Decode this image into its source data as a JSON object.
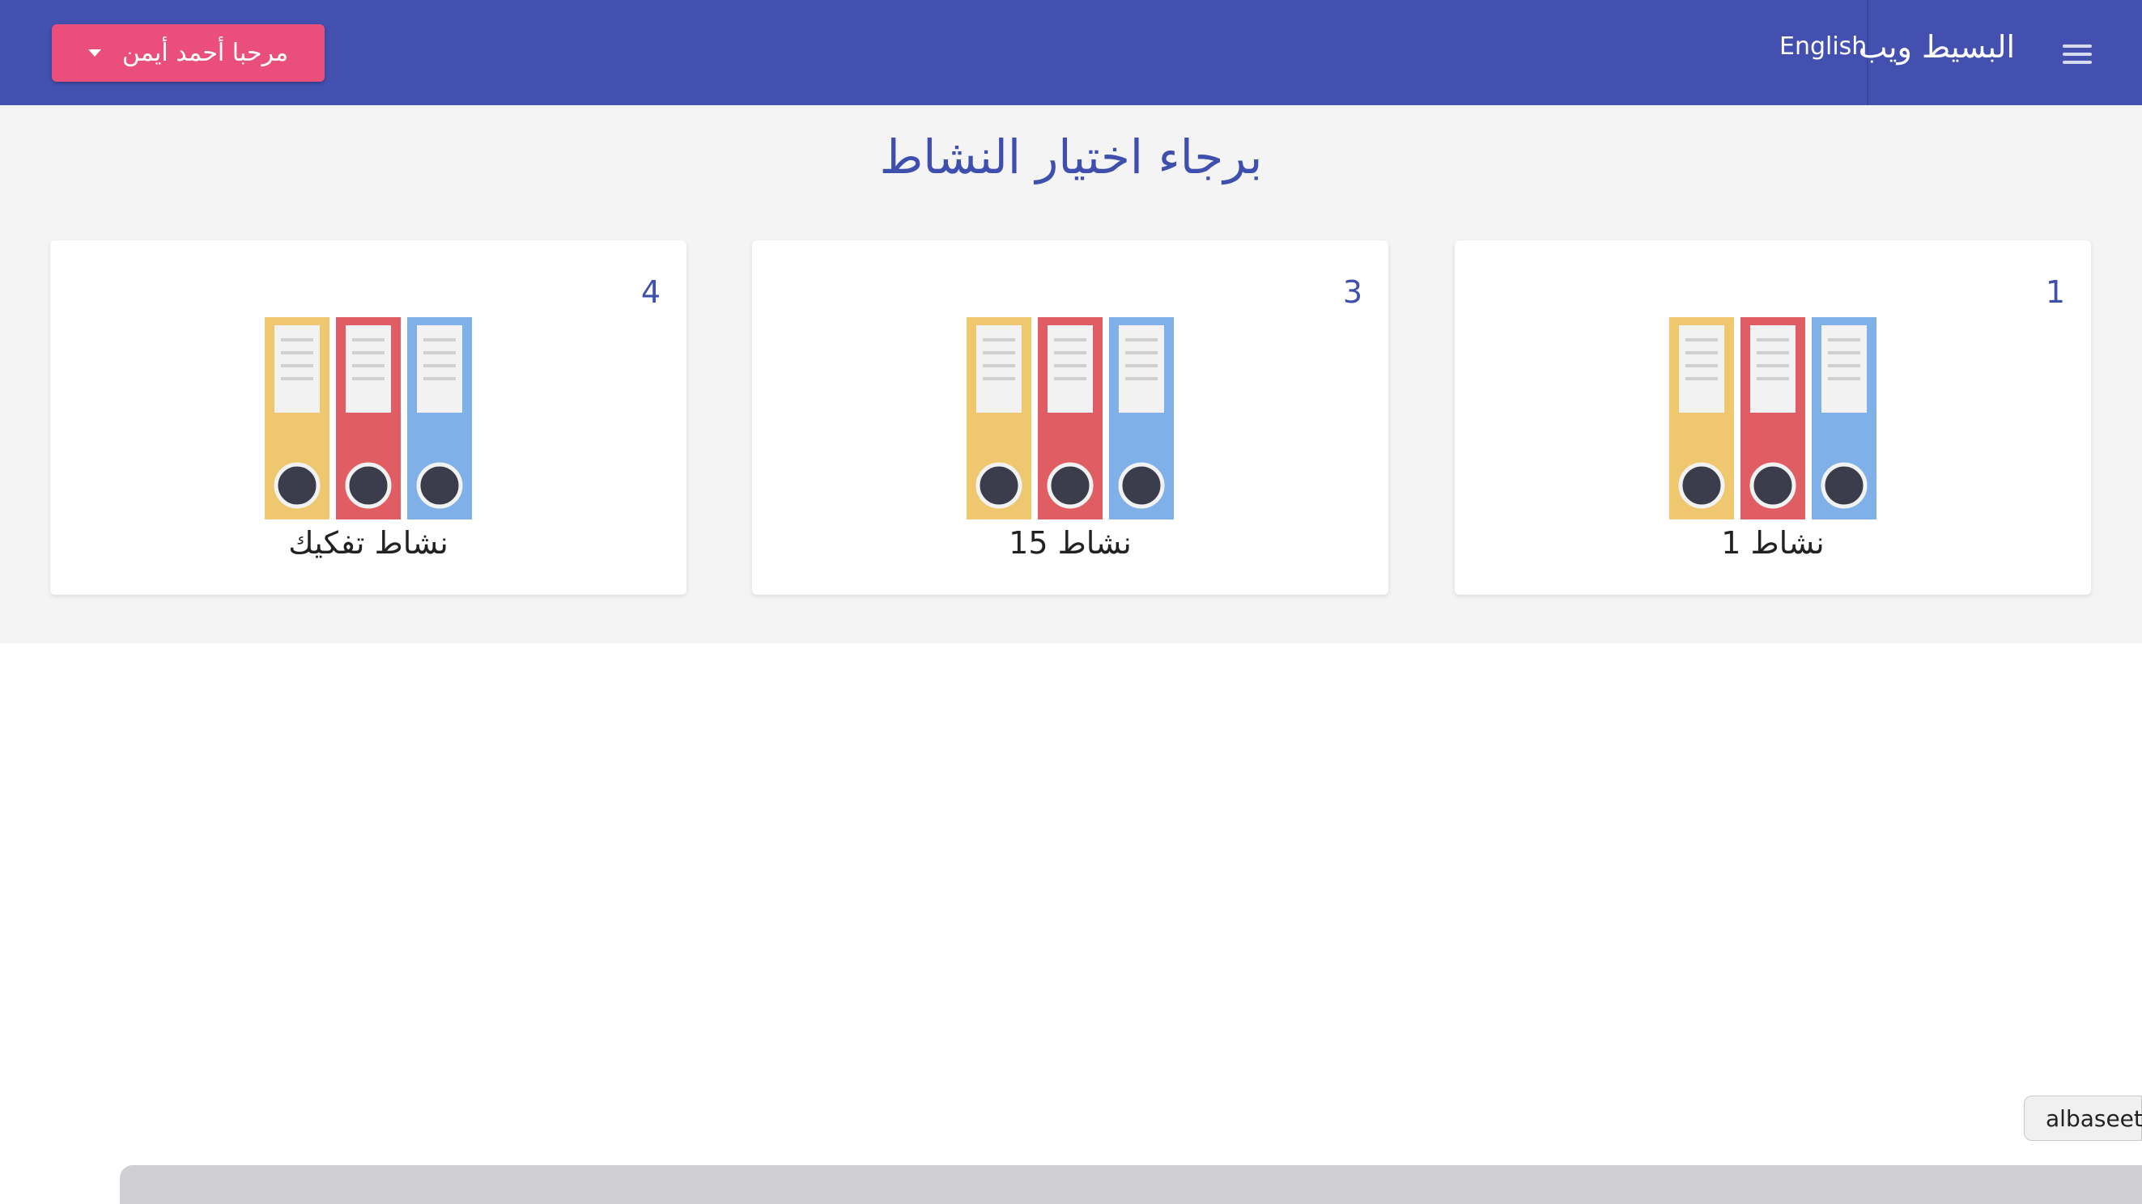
{
  "navbar": {
    "user_button": "مرحبا أحمد أيمن",
    "brand": "البسيط ويب",
    "language": "English"
  },
  "page": {
    "title": "برجاء اختيار النشاط"
  },
  "cards": [
    {
      "number": "1",
      "label": "نشاط 1"
    },
    {
      "number": "3",
      "label": "نشاط 15"
    },
    {
      "number": "4",
      "label": "نشاط تفكيك"
    }
  ],
  "tooltip": "albaseet-",
  "icons": {
    "menu": "hamburger-menu-icon",
    "dropdown": "caret-down-icon",
    "activity": "binders-icon"
  },
  "colors": {
    "navbar": "#4350b0",
    "user_button": "#ea4f7c",
    "title": "#3f4fae",
    "binder_yellow": "#efc76f",
    "binder_red": "#df5d63",
    "binder_blue": "#7fb0e8"
  }
}
